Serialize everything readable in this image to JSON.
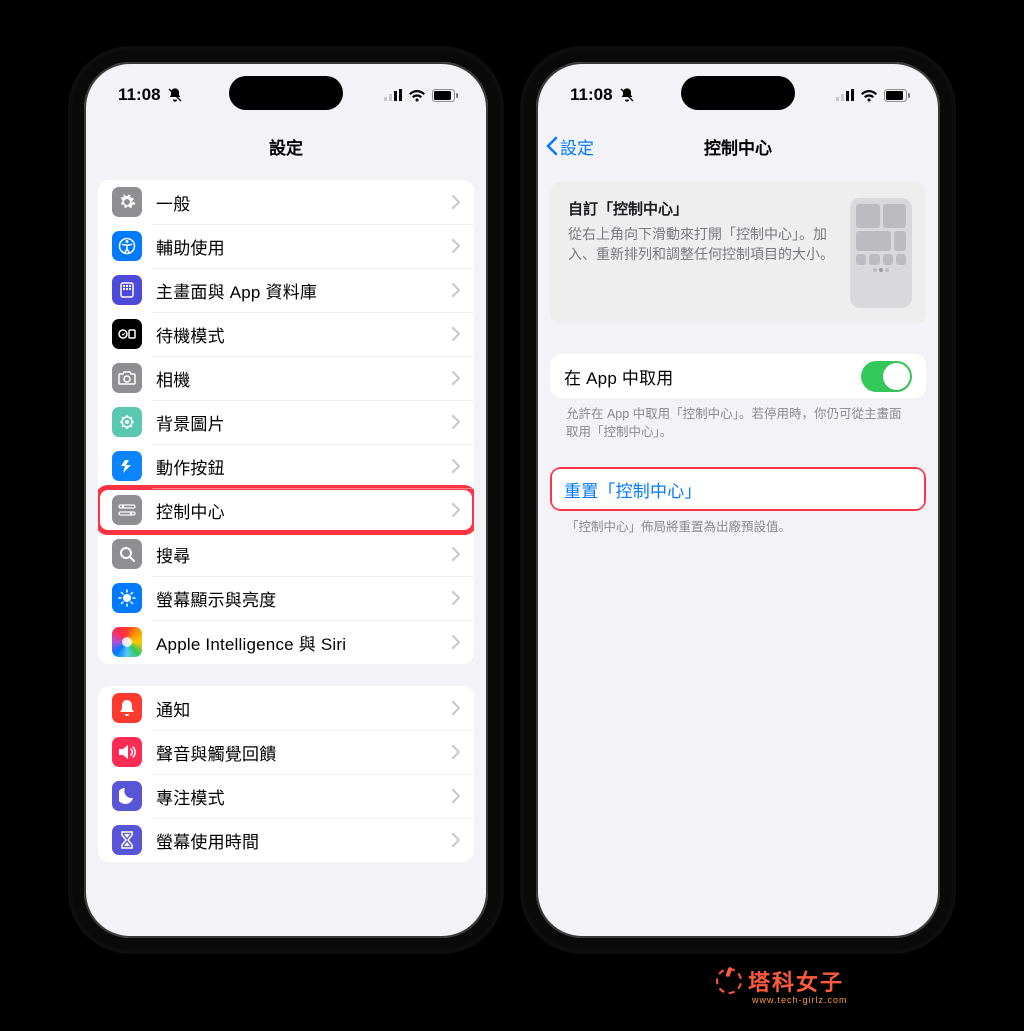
{
  "statusbar": {
    "time": "11:08"
  },
  "phone1": {
    "title": "設定",
    "group1": [
      {
        "label": "一般"
      },
      {
        "label": "輔助使用"
      },
      {
        "label": "主畫面與 App 資料庫"
      },
      {
        "label": "待機模式"
      },
      {
        "label": "相機"
      },
      {
        "label": "背景圖片"
      },
      {
        "label": "動作按鈕"
      },
      {
        "label": "控制中心"
      },
      {
        "label": "搜尋"
      },
      {
        "label": "螢幕顯示與亮度"
      },
      {
        "label": "Apple Intelligence 與 Siri"
      }
    ],
    "group2": [
      {
        "label": "通知"
      },
      {
        "label": "聲音與觸覺回饋"
      },
      {
        "label": "專注模式"
      },
      {
        "label": "螢幕使用時間"
      }
    ]
  },
  "phone2": {
    "back": "設定",
    "title": "控制中心",
    "customize": {
      "title": "自訂「控制中心」",
      "desc": "從右上角向下滑動來打開「控制中心」。加入、重新排列和調整任何控制項目的大小。"
    },
    "access": {
      "label": "在 App 中取用",
      "footer": "允許在 App 中取用「控制中心」。若停用時，你仍可從主畫面取用「控制中心」。"
    },
    "reset": {
      "label": "重置「控制中心」",
      "footer": "「控制中心」佈局將重置為出廠預設值。"
    }
  },
  "watermark": {
    "main": "塔科女子",
    "sub": "www.tech-girlz.com"
  }
}
